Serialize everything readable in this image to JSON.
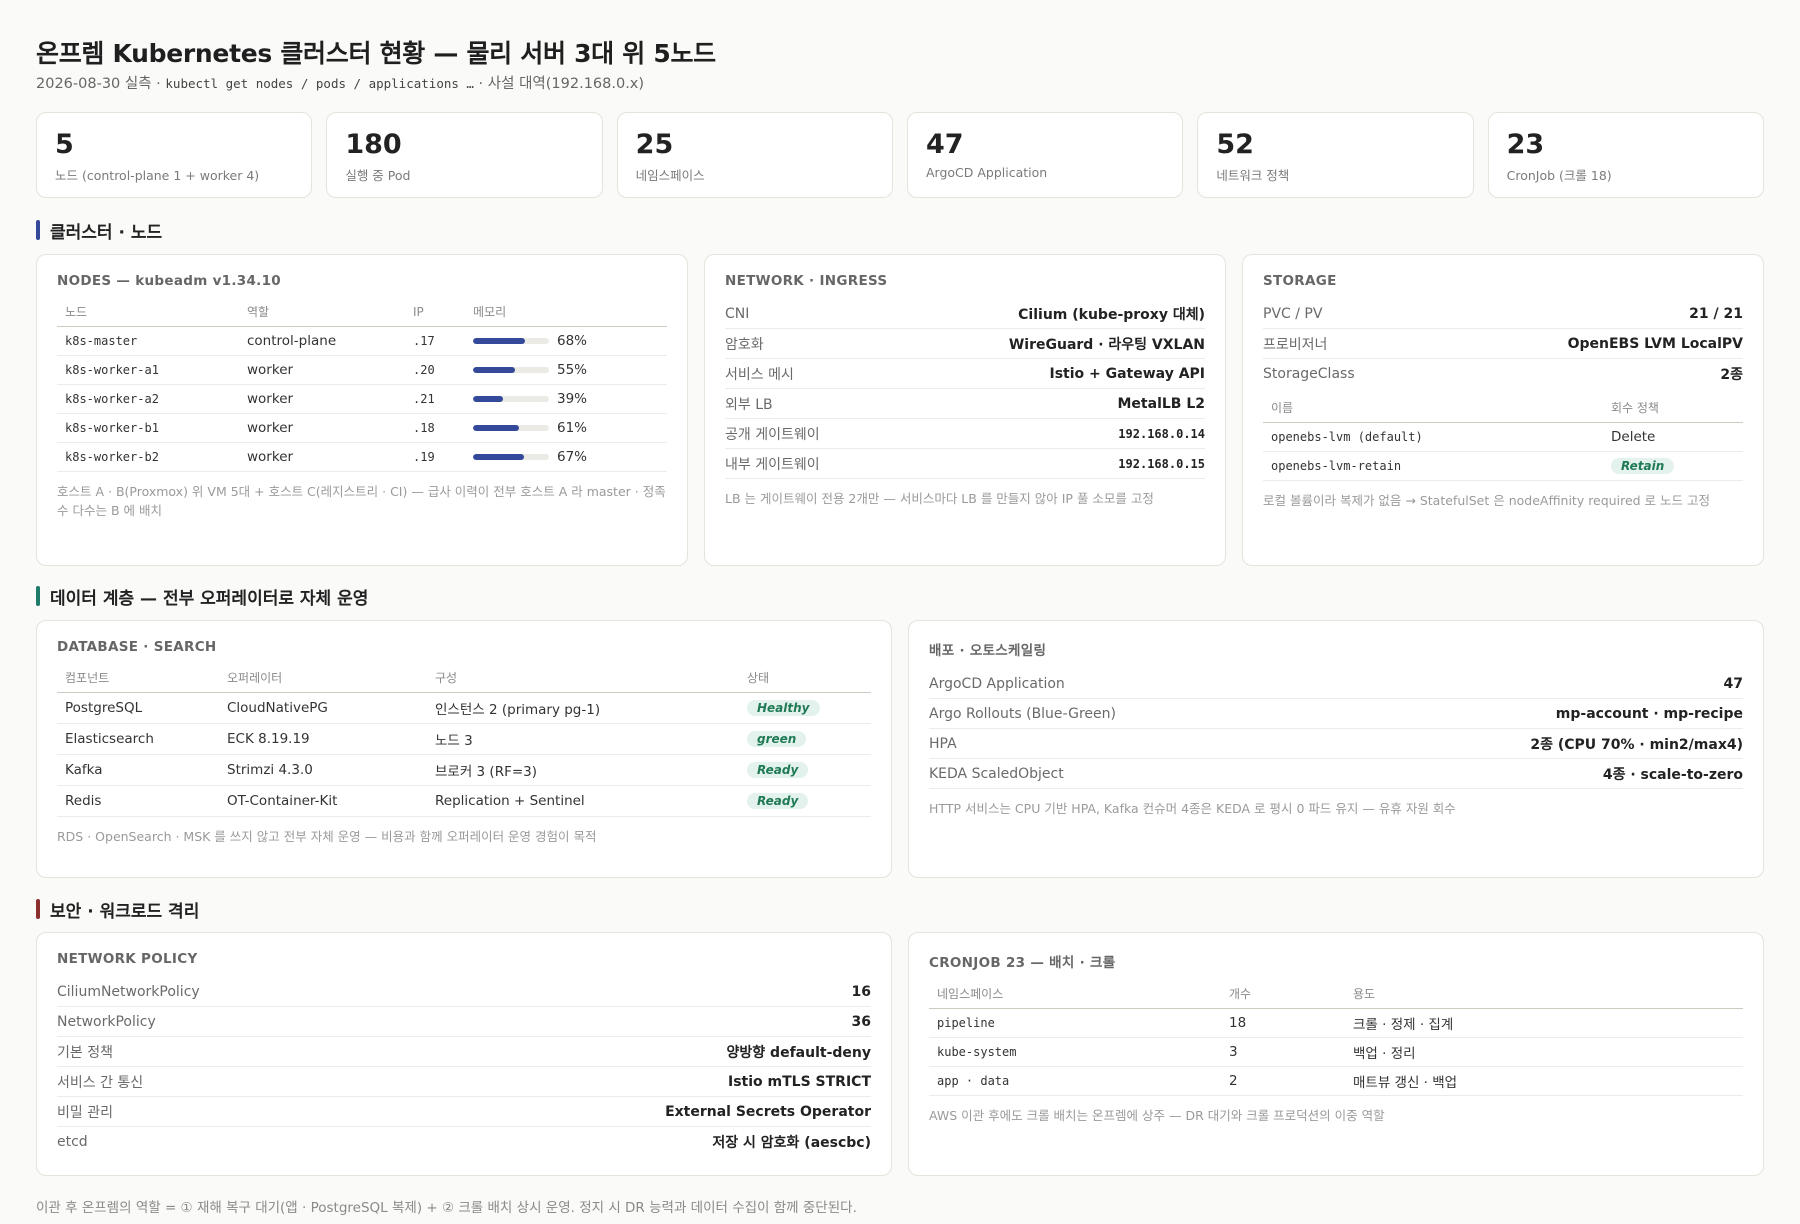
{
  "header": {
    "title": "온프렘 Kubernetes 클러스터 현황 — 물리 서버 3대 위 5노드",
    "subtitle_prefix": "2026-08-30 실측 · ",
    "subtitle_cmd": "kubectl get nodes / pods / applications …",
    "subtitle_suffix": " · 사설 대역(192.168.0.x)"
  },
  "kpis": [
    {
      "value": "5",
      "label": "노드 (control-plane 1 + worker 4)"
    },
    {
      "value": "180",
      "label": "실행 중 Pod"
    },
    {
      "value": "25",
      "label": "네임스페이스"
    },
    {
      "value": "47",
      "label": "ArgoCD Application"
    },
    {
      "value": "52",
      "label": "네트워크 정책"
    },
    {
      "value": "23",
      "label": "CronJob (크롤 18)"
    }
  ],
  "sections": {
    "cluster": "클러스터 · 노드",
    "data": "데이터 계층 — 전부 오퍼레이터로 자체 운영",
    "security": "보안 · 워크로드 격리"
  },
  "colors": {
    "section_cluster": "#34499a",
    "section_data": "#1f7a6a",
    "section_security": "#8b2f2f",
    "memory_bar": "#34499a",
    "badge_bg": "#e3f2ec",
    "badge_text": "#1f7a55"
  },
  "nodes_panel": {
    "title": "NODES — kubeadm v1.34.10",
    "headers": [
      "노드",
      "역할",
      "IP",
      "메모리"
    ],
    "rows": [
      {
        "name": "k8s-master",
        "role": "control-plane",
        "ip": ".17",
        "mem_pct": 68,
        "mem_label": "68%"
      },
      {
        "name": "k8s-worker-a1",
        "role": "worker",
        "ip": ".20",
        "mem_pct": 55,
        "mem_label": "55%"
      },
      {
        "name": "k8s-worker-a2",
        "role": "worker",
        "ip": ".21",
        "mem_pct": 39,
        "mem_label": "39%"
      },
      {
        "name": "k8s-worker-b1",
        "role": "worker",
        "ip": ".18",
        "mem_pct": 61,
        "mem_label": "61%"
      },
      {
        "name": "k8s-worker-b2",
        "role": "worker",
        "ip": ".19",
        "mem_pct": 67,
        "mem_label": "67%"
      }
    ],
    "note": "호스트 A · B(Proxmox) 위 VM 5대 + 호스트 C(레지스트리 · CI) — 급사 이력이 전부 호스트 A 라 master · 정족수 다수는 B 에 배치"
  },
  "network_panel": {
    "title": "NETWORK · INGRESS",
    "rows": [
      {
        "key": "CNI",
        "value": "Cilium (kube-proxy 대체)"
      },
      {
        "key": "암호화",
        "value": "WireGuard · 라우팅 VXLAN"
      },
      {
        "key": "서비스 메시",
        "value": "Istio + Gateway API"
      },
      {
        "key": "외부 LB",
        "value": "MetalLB L2"
      },
      {
        "key": "공개 게이트웨이",
        "value": "192.168.0.14"
      },
      {
        "key": "내부 게이트웨이",
        "value": "192.168.0.15"
      }
    ],
    "note": "LB 는 게이트웨이 전용 2개만 — 서비스마다 LB 를 만들지 않아 IP 풀 소모를 고정"
  },
  "storage_panel": {
    "title": "STORAGE",
    "rows": [
      {
        "key": "PVC / PV",
        "value": "21 / 21"
      },
      {
        "key": "프로비저너",
        "value": "OpenEBS LVM LocalPV"
      },
      {
        "key": "StorageClass",
        "value": "2종"
      }
    ],
    "headers": [
      "이름",
      "회수 정책"
    ],
    "classes": [
      {
        "name": "openebs-lvm (default)",
        "policy": "Delete"
      },
      {
        "name": "openebs-lvm-retain",
        "policy": "Retain"
      }
    ],
    "note": "로컬 볼륨이라 복제가 없음 → StatefulSet 은 nodeAffinity required 로 노드 고정"
  },
  "database_panel": {
    "title": "DATABASE · SEARCH",
    "headers": [
      "컴포넌트",
      "오퍼레이터",
      "구성",
      "상태"
    ],
    "rows": [
      {
        "component": "PostgreSQL",
        "operator": "CloudNativePG",
        "config": "인스턴스 2 (primary pg-1)",
        "status": "Healthy"
      },
      {
        "component": "Elasticsearch",
        "operator": "ECK 8.19.19",
        "config": "노드 3",
        "status": "green"
      },
      {
        "component": "Kafka",
        "operator": "Strimzi 4.3.0",
        "config": "브로커 3 (RF=3)",
        "status": "Ready"
      },
      {
        "component": "Redis",
        "operator": "OT-Container-Kit",
        "config": "Replication + Sentinel",
        "status": "Ready"
      }
    ],
    "note": "RDS · OpenSearch · MSK 를 쓰지 않고 전부 자체 운영 — 비용과 함께 오퍼레이터 운영 경험이 목적"
  },
  "deploy_panel": {
    "title": "배포 · 오토스케일링",
    "rows": [
      {
        "key": "ArgoCD Application",
        "value": "47"
      },
      {
        "key": "Argo Rollouts (Blue-Green)",
        "value": "mp-account · mp-recipe"
      },
      {
        "key": "HPA",
        "value": "2종 (CPU 70% · min2/max4)"
      },
      {
        "key": "KEDA ScaledObject",
        "value": "4종 · scale-to-zero"
      }
    ],
    "note": "HTTP 서비스는 CPU 기반 HPA, Kafka 컨슈머 4종은 KEDA 로 평시 0 파드 유지 — 유휴 자원 회수"
  },
  "netpol_panel": {
    "title": "NETWORK POLICY",
    "rows": [
      {
        "key": "CiliumNetworkPolicy",
        "value": "16"
      },
      {
        "key": "NetworkPolicy",
        "value": "36"
      },
      {
        "key": "기본 정책",
        "value": "양방향 default-deny"
      },
      {
        "key": "서비스 간 통신",
        "value": "Istio mTLS STRICT"
      },
      {
        "key": "비밀 관리",
        "value": "External Secrets Operator"
      },
      {
        "key": "etcd",
        "value": "저장 시 암호화 (aescbc)"
      }
    ]
  },
  "cronjob_panel": {
    "title": "CRONJOB 23 — 배치 · 크롤",
    "headers": [
      "네임스페이스",
      "개수",
      "용도"
    ],
    "rows": [
      {
        "namespace": "pipeline",
        "count": "18",
        "purpose": "크롤 · 정제 · 집계"
      },
      {
        "namespace": "kube-system",
        "count": "3",
        "purpose": "백업 · 정리"
      },
      {
        "namespace": "app · data",
        "count": "2",
        "purpose": "매트뷰 갱신 · 백업"
      }
    ],
    "note": "AWS 이관 후에도 크롤 배치는 온프렘에 상주 — DR 대기와 크롤 프로덕션의 이중 역할"
  },
  "footer": "이관 후 온프렘의 역할 = ① 재해 복구 대기(앱 · PostgreSQL 복제) + ② 크롤 배치 상시 운영. 정지 시 DR 능력과 데이터 수집이 함께 중단된다."
}
